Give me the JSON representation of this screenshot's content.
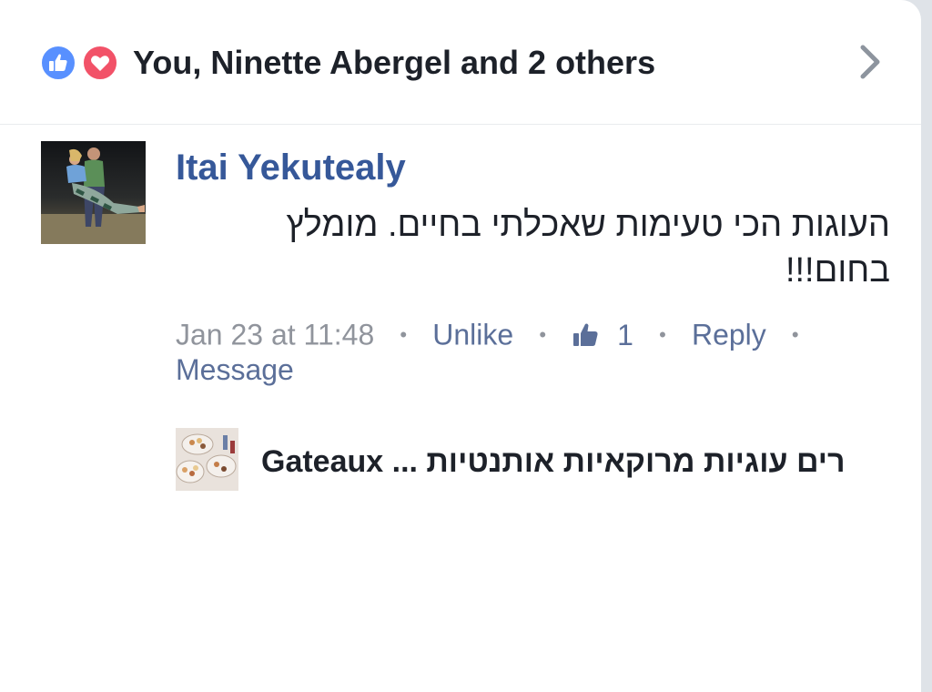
{
  "reactions": {
    "like_icon": "like-icon",
    "love_icon": "love-icon",
    "like_color": "#5890ff",
    "love_color": "#f25268",
    "summary": "You, Ninette Abergel and 2 others"
  },
  "comment": {
    "author": "Itai Yekutealy",
    "text": "העוגות הכי טעימות שאכלתי בחיים. מומלץ בחום!!!",
    "timestamp": "Jan 23 at 11:48",
    "unlike_label": "Unlike",
    "like_count": "1",
    "reply_label": "Reply",
    "message_label": "Message",
    "separator": "•"
  },
  "link_preview": {
    "text": "Gateaux ... רים עוגיות מרוקאיות אותנטיות"
  },
  "colors": {
    "link": "#365899",
    "meta": "#90949c",
    "action": "#5b6f99"
  }
}
